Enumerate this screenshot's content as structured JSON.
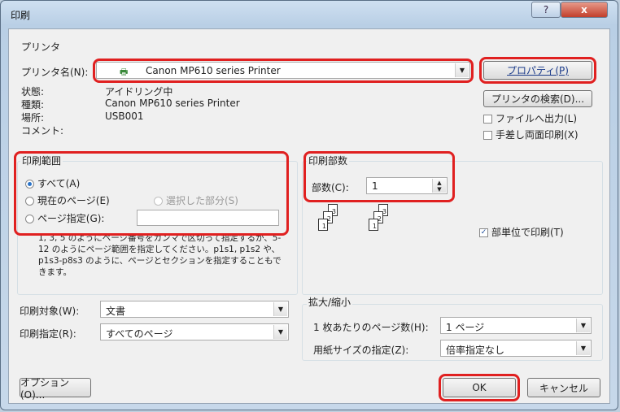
{
  "window": {
    "title": "印刷",
    "help": "?",
    "close": "x"
  },
  "printer": {
    "group_label": "プリンタ",
    "name_label": "プリンタ名(N):",
    "name_value": "Canon MP610 series Printer",
    "status_label": "状態:",
    "status_value": "アイドリング中",
    "type_label": "種類:",
    "type_value": "Canon MP610 series Printer",
    "location_label": "場所:",
    "location_value": "USB001",
    "comment_label": "コメント:",
    "properties_button": "プロパティ(P)",
    "find_button": "プリンタの検索(D)...",
    "print_to_file": "ファイルへ出力(L)",
    "manual_duplex": "手差し両面印刷(X)"
  },
  "range": {
    "group_label": "印刷範囲",
    "all": "すべて(A)",
    "current_page": "現在のページ(E)",
    "selection": "選択した部分(S)",
    "pages": "ページ指定(G):",
    "pages_value": "",
    "hint": "1, 3, 5 のようにページ番号をカンマで区切って指定するか、5-12 のようにページ範囲を指定してください。p1s1, p1s2 や、p1s3-p8s3 のように、ページとセクションを指定することもできます。"
  },
  "copies": {
    "group_label": "印刷部数",
    "count_label": "部数(C):",
    "count_value": "1",
    "collate": "部単位で印刷(T)",
    "collate_checked": true
  },
  "print_what": {
    "label": "印刷対象(W):",
    "value": "文書"
  },
  "print_pages": {
    "label": "印刷指定(R):",
    "value": "すべてのページ"
  },
  "zoom": {
    "group_label": "拡大/縮小",
    "pages_per_sheet_label": "1 枚あたりのページ数(H):",
    "pages_per_sheet_value": "1 ページ",
    "scale_label": "用紙サイズの指定(Z):",
    "scale_value": "倍率指定なし"
  },
  "buttons": {
    "options": "オプション(O)...",
    "ok": "OK",
    "cancel": "キャンセル"
  }
}
